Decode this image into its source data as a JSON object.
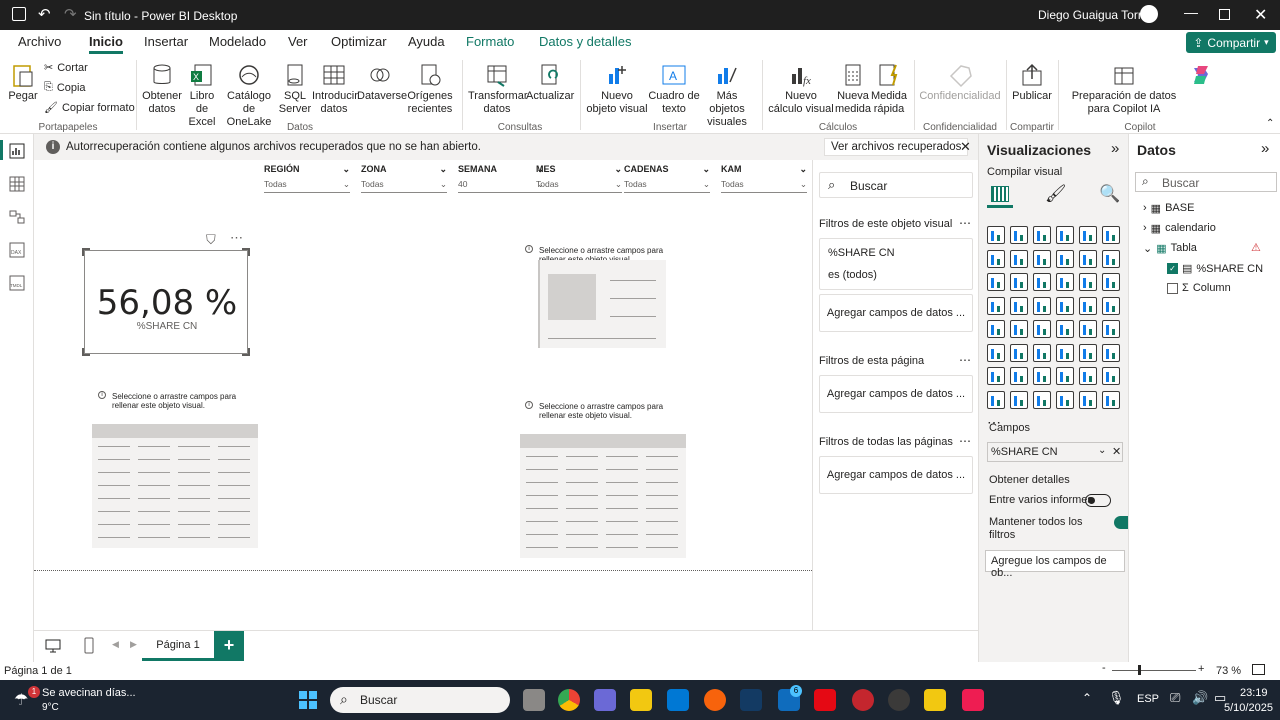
{
  "titlebar": {
    "doc_title": "Sin título - Power BI Desktop",
    "user": "Diego Guaigua Torres"
  },
  "menu": {
    "tabs": [
      "Archivo",
      "Inicio",
      "Insertar",
      "Modelado",
      "Ver",
      "Optimizar",
      "Ayuda",
      "Formato",
      "Datos y detalles"
    ],
    "share": "Compartir"
  },
  "ribbon": {
    "paste": "Pegar",
    "cut": "Cortar",
    "copy": "Copia",
    "format_painter": "Copiar formato",
    "get_data": "Obtener datos",
    "excel": "Libro de Excel",
    "onelake": "Catálogo de OneLake",
    "sql": "SQL Server",
    "enter_data": "Introducir datos",
    "dataverse": "Dataverse",
    "recent": "Orígenes recientes",
    "transform": "Transformar datos",
    "refresh": "Actualizar",
    "new_visual": "Nuevo objeto visual",
    "textbox": "Cuadro de texto",
    "more_visuals": "Más objetos visuales",
    "new_calc": "Nuevo cálculo visual",
    "new_measure": "Nueva medida",
    "quick_measure": "Medida rápida",
    "sensitivity": "Confidencialidad",
    "publish": "Publicar",
    "copilot_prep": "Preparación de datos para Copilot IA",
    "groups": {
      "clipboard": "Portapapeles",
      "data": "Datos",
      "queries": "Consultas",
      "insert": "Insertar",
      "calculations": "Cálculos",
      "sensitivity": "Confidencialidad",
      "share": "Compartir",
      "copilot": "Copilot"
    }
  },
  "notice": {
    "text": "Autorrecuperación contiene algunos archivos recuperados que no se han abierto.",
    "button": "Ver archivos recuperados"
  },
  "slicers": [
    {
      "label": "REGIÓN",
      "value": "Todas"
    },
    {
      "label": "ZONA",
      "value": "Todas"
    },
    {
      "label": "SEMANA",
      "value": "40"
    },
    {
      "label": "MES",
      "value": "Todas"
    },
    {
      "label": "CADENAS",
      "value": "Todas"
    },
    {
      "label": "KAM",
      "value": "Todas"
    }
  ],
  "card": {
    "value": "56,08 %",
    "label": "%SHARE CN"
  },
  "placeholder_hint": "Seleccione o arrastre campos para rellenar este objeto visual.",
  "pages": {
    "current": "Página 1",
    "status": "Página 1 de 1",
    "zoom": "73 %"
  },
  "filters": {
    "search": "Buscar",
    "visual_header": "Filtros de este objeto visual",
    "field": "%SHARE CN",
    "field_state": "es (todos)",
    "add": "Agregar campos de datos ...",
    "page_header": "Filtros de esta página",
    "all_header": "Filtros de todas las páginas"
  },
  "viz": {
    "title": "Visualizaciones",
    "build": "Compilar visual",
    "fields_label": "Campos",
    "field_chip": "%SHARE CN",
    "drill": "Obtener detalles",
    "cross_report": "Entre varios informes",
    "keep_filters": "Mantener todos los filtros",
    "add_drill": "Agregue los campos de ob..."
  },
  "data": {
    "title": "Datos",
    "search": "Buscar",
    "tables": [
      "BASE",
      "calendario",
      "Tabla"
    ],
    "fields": [
      "%SHARE CN",
      "Column"
    ]
  },
  "taskbar": {
    "weather_title": "Se avecinan días...",
    "weather_temp": "9°C",
    "search": "Buscar",
    "lang": "ESP",
    "time": "23:19",
    "date": "5/10/2025",
    "badge_weather": "1",
    "badge_app": "6"
  },
  "colors": {
    "accent": "#117865",
    "titlebar": "#1f1f1f",
    "taskbar": "#1b2430"
  }
}
